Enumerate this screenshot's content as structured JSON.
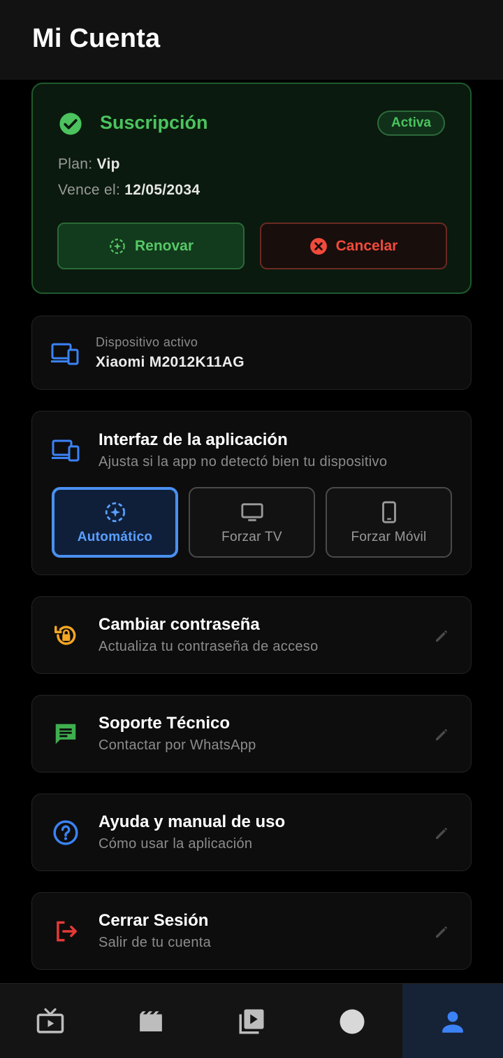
{
  "header": {
    "title": "Mi Cuenta"
  },
  "subscription": {
    "title": "Suscripción",
    "badge": "Activa",
    "plan_label": "Plan:",
    "plan_value": "Vip",
    "expires_label": "Vence el:",
    "expires_value": "12/05/2034",
    "renew_label": "Renovar",
    "cancel_label": "Cancelar"
  },
  "device": {
    "label": "Dispositivo activo",
    "value": "Xiaomi M2012K11AG"
  },
  "interface": {
    "title": "Interfaz de la aplicación",
    "subtitle": "Ajusta si la app no detectó bien tu dispositivo",
    "modes": [
      {
        "label": "Automático",
        "selected": true
      },
      {
        "label": "Forzar TV",
        "selected": false
      },
      {
        "label": "Forzar Móvil",
        "selected": false
      }
    ]
  },
  "options": [
    {
      "title": "Cambiar contraseña",
      "subtitle": "Actualiza tu contraseña de acceso",
      "icon": "lock-reset-icon",
      "color": "#f5a623"
    },
    {
      "title": "Soporte Técnico",
      "subtitle": "Contactar por WhatsApp",
      "icon": "chat-icon",
      "color": "#3fae4f"
    },
    {
      "title": "Ayuda y manual de uso",
      "subtitle": "Cómo usar la aplicación",
      "icon": "help-icon",
      "color": "#3b82f6"
    },
    {
      "title": "Cerrar Sesión",
      "subtitle": "Salir de tu cuenta",
      "icon": "logout-icon",
      "color": "#e53935"
    }
  ],
  "navbar": {
    "items": [
      "live-tv-icon",
      "movies-icon",
      "series-icon",
      "circle-icon",
      "account-icon"
    ],
    "active_index": 4
  },
  "colors": {
    "accent_green": "#4cc35e",
    "accent_red": "#f24a3b",
    "accent_blue": "#4a90f0"
  }
}
